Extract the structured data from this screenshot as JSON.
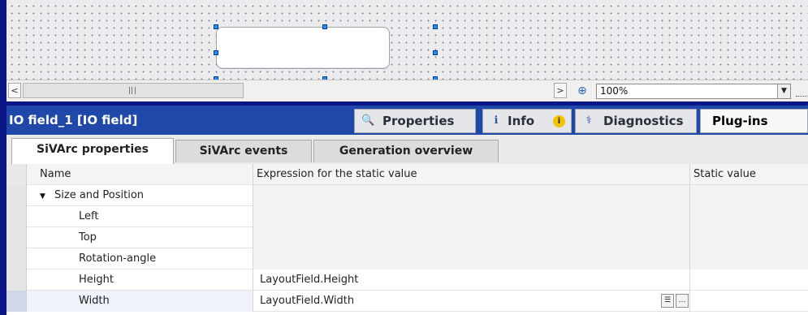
{
  "editor": {
    "zoom_value": "100%",
    "scroll_grip_label": "III"
  },
  "inspector": {
    "title": "IO field_1 [IO field]",
    "tabs": [
      {
        "label": "Properties",
        "icon": "properties-icon"
      },
      {
        "label": "Info",
        "icon": "info-tab-icon",
        "badge": "i"
      },
      {
        "label": "Diagnostics",
        "icon": "diagnostics-icon"
      },
      {
        "label": "Plug-ins",
        "active": true
      }
    ]
  },
  "subtabs": [
    {
      "label": "SiVArc properties",
      "active": true
    },
    {
      "label": "SiVArc events"
    },
    {
      "label": "Generation overview"
    }
  ],
  "grid": {
    "columns": [
      "Name",
      "Expression for the static value",
      "Static value"
    ],
    "rows": [
      {
        "name": "Size and Position",
        "expression": "",
        "static": "",
        "group": true
      },
      {
        "name": "Left",
        "expression": "",
        "static": ""
      },
      {
        "name": "Top",
        "expression": "",
        "static": ""
      },
      {
        "name": "Rotation-angle",
        "expression": "",
        "static": ""
      },
      {
        "name": "Height",
        "expression": "LayoutField.Height",
        "static": ""
      },
      {
        "name": "Width",
        "expression": "LayoutField.Width",
        "static": ""
      }
    ]
  },
  "colors": {
    "background": "#0e1a8e",
    "selection_handle": "#1f8fff",
    "info_badge": "#f1c400"
  }
}
